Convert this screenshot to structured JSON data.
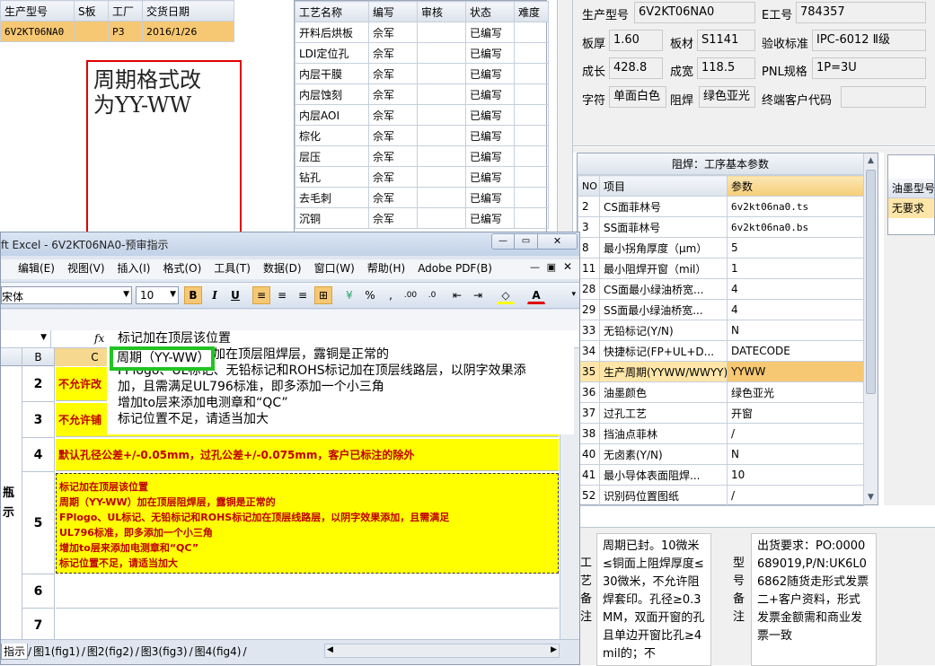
{
  "left_top": {
    "headers": [
      "生产型号",
      "S板",
      "工厂",
      "交货日期"
    ],
    "row": [
      "6V2KT06NA0",
      "",
      "P3",
      "2016/1/26"
    ]
  },
  "annotation": {
    "text": "周期格式改为YY-WW"
  },
  "proc_table": {
    "headers": [
      "工艺名称",
      "编写",
      "审核",
      "状态",
      "难度"
    ],
    "rows": [
      [
        "开料后烘板",
        "佘军",
        "",
        "已编写"
      ],
      [
        "LDI定位孔",
        "佘军",
        "",
        "已编写"
      ],
      [
        "内层干膜",
        "佘军",
        "",
        "已编写"
      ],
      [
        "内层蚀刻",
        "佘军",
        "",
        "已编写"
      ],
      [
        "内层AOI",
        "佘军",
        "",
        "已编写"
      ],
      [
        "棕化",
        "佘军",
        "",
        "已编写"
      ],
      [
        "层压",
        "佘军",
        "",
        "已编写"
      ],
      [
        "钻孔",
        "佘军",
        "",
        "已编写"
      ],
      [
        "去毛刺",
        "佘军",
        "",
        "已编写"
      ],
      [
        "沉铜",
        "佘军",
        "",
        "已编写"
      ]
    ]
  },
  "info": {
    "model_label": "生产型号",
    "model": "6V2KT06NA0",
    "eno_label": "E工号",
    "eno": "784357",
    "thick_label": "板厚",
    "thick": "1.60",
    "mat_label": "板材",
    "mat": "S1141",
    "std_label": "验收标准",
    "std": "IPC-6012 Ⅱ级",
    "len_label": "成长",
    "len": "428.8",
    "wid_label": "成宽",
    "wid": "118.5",
    "pnl_label": "PNL规格",
    "pnl": "1P=3U",
    "char_label": "字符",
    "char": "单面白色",
    "mask_label": "阻焊",
    "mask": "绿色亚光",
    "cust_label": "终端客户代码",
    "cust": ""
  },
  "params": {
    "title": "阻焊：工序基本参数",
    "headers": [
      "NO",
      "项目",
      "参数"
    ],
    "rows": [
      [
        "2",
        "CS面菲林号",
        "6v2kt06na0.ts"
      ],
      [
        "3",
        "SS面菲林号",
        "6v2kt06na0.bs"
      ],
      [
        "8",
        "最小拐角厚度（μm）",
        "5"
      ],
      [
        "11",
        "最小阻焊开窗（mil）",
        "1"
      ],
      [
        "28",
        "CS面最小绿油桥宽...",
        "4"
      ],
      [
        "29",
        "SS面最小绿油桥宽...",
        "4"
      ],
      [
        "33",
        "无铅标记(Y/N)",
        "N"
      ],
      [
        "34",
        "快捷标记(FP+UL+D...",
        "DATECODE"
      ],
      [
        "35",
        "生产周期(YYWW/WWYY)",
        "YYWW"
      ],
      [
        "36",
        "油墨颜色",
        "绿色亚光"
      ],
      [
        "37",
        "过孔工艺",
        "开窗"
      ],
      [
        "38",
        "挡油点菲林",
        "/"
      ],
      [
        "40",
        "无卤素(Y/N)",
        "N"
      ],
      [
        "41",
        "最小导体表面阻焊...",
        "10"
      ],
      [
        "52",
        "识别码位置图纸",
        "/"
      ]
    ]
  },
  "ink": {
    "header": "油墨型号",
    "value": "无要求"
  },
  "notes": {
    "process_label": "工艺备注",
    "process_text": "周期已封。10微米≤铜面上阻焊厚度≤30微米，不允许阻焊套印。孔径≥0.3MM，双面开窗的孔且单边开窗比孔≥4mil的；不",
    "model_label": "型号备注",
    "model_text": "出货要求：PO:0000689019,P/N:UK6L06862随货走形式发票二+客户资料，形式发票金额需和商业发票一致"
  },
  "excel": {
    "title": "ft Excel - 6V2KT06NA0-预审指示",
    "menu": [
      "编辑(E)",
      "视图(V)",
      "插入(I)",
      "格式(O)",
      "工具(T)",
      "数据(D)",
      "窗口(W)",
      "帮助(H)",
      "Adobe PDF(B)"
    ],
    "font": "宋体",
    "size": "10",
    "fx": "fx",
    "formula_lines": [
      "标记加在顶层该位置",
      "周期（YY-WW）加在顶层阻焊层，露铜是正常的",
      "FPlogo、UL标记、无铅标记和ROHS标记加在顶层线路层，以阴字效果添",
      "加，且需满足UL796标准，即多添加一个小三角",
      "增加to层来添加电测章和“QC”",
      "标记位置不足，请适当加大"
    ],
    "formula_hidden_part": "周期（YY-WW）",
    "formula_visible_rest": "加在顶层阻焊层，露铜是正常的",
    "formula_line3_prefix": "FPlogo、UL标记",
    "formula_line3_rest": "、无铅标记和ROHS标记加在顶层线路层，以阴字效果添",
    "col_b": "B",
    "col_c": "C",
    "rows": [
      {
        "n": "2",
        "text": "不允许改"
      },
      {
        "n": "3",
        "text": "不允许铺"
      },
      {
        "n": "4",
        "text": "默认孔径公差+/-0.05mm，过孔公差+/-0.075mm，客户已标注的除外"
      },
      {
        "n": "5",
        "lines": [
          "标记加在顶层该位置",
          "周期（YY-WW）加在顶层阻焊层，露铜是正常的",
          "FPlogo、UL标记、无铅标记和ROHS标记加在顶层线路层，以阴字效果添加，且需满足",
          "UL796标准，即多添加一个小三角",
          "增加to层来添加电测章和“QC”",
          "标记位置不足，请适当加大"
        ]
      },
      {
        "n": "6",
        "text": ""
      },
      {
        "n": "7",
        "text": ""
      }
    ],
    "left_frag_a": "瓶",
    "left_frag_b": "示",
    "tabs": [
      "指示",
      "图1(fig1)",
      "图2(fig2)",
      "图3(fig3)",
      "图4(fig4)"
    ]
  }
}
